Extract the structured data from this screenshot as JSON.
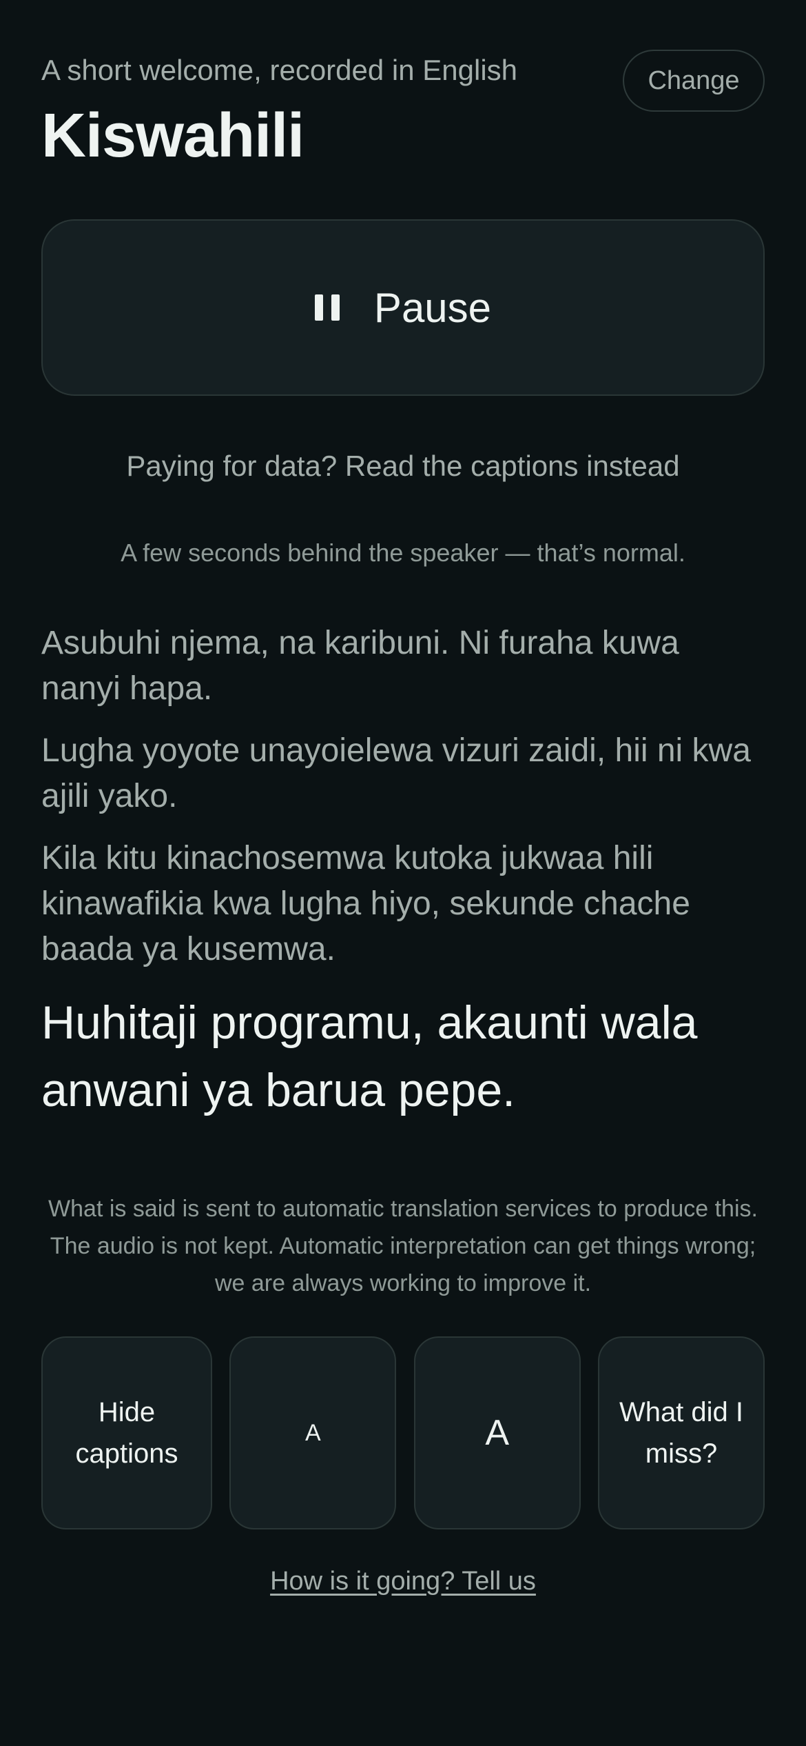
{
  "header": {
    "subtitle": "A short welcome, recorded in English",
    "language": "Kiswahili",
    "change_label": "Change"
  },
  "player": {
    "state_label": "Pause",
    "icon": "pause-icon"
  },
  "data_note": "Paying for data? Read the captions instead",
  "delay_note": "A few seconds behind the speaker — that’s normal.",
  "captions": {
    "previous": [
      "Asubuhi njema, na karibuni. Ni furaha kuwa nanyi hapa.",
      "Lugha yoyote unayoielewa vizuri zaidi, hii ni kwa ajili yako.",
      "Kila kitu kinachosemwa kutoka jukwaa hili kinawafikia kwa lugha hiyo, sekunde chache baada ya kusemwa."
    ],
    "current": "Huhitaji programu, akaunti wala anwani ya barua pepe."
  },
  "disclaimer": "What is said is sent to automatic translation services to produce this. The audio is not kept. Automatic interpretation can get things wrong; we are always working to improve it.",
  "controls": {
    "hide_captions": "Hide captions",
    "smaller_text": "A",
    "larger_text": "A",
    "what_did_i_miss": "What did I miss?"
  },
  "feedback_link": "How is it going? Tell us",
  "colors": {
    "background": "#0b1214",
    "surface": "#151f22",
    "border": "#2a3636",
    "text_primary": "#eef3f1",
    "text_secondary": "#a4aeab"
  }
}
